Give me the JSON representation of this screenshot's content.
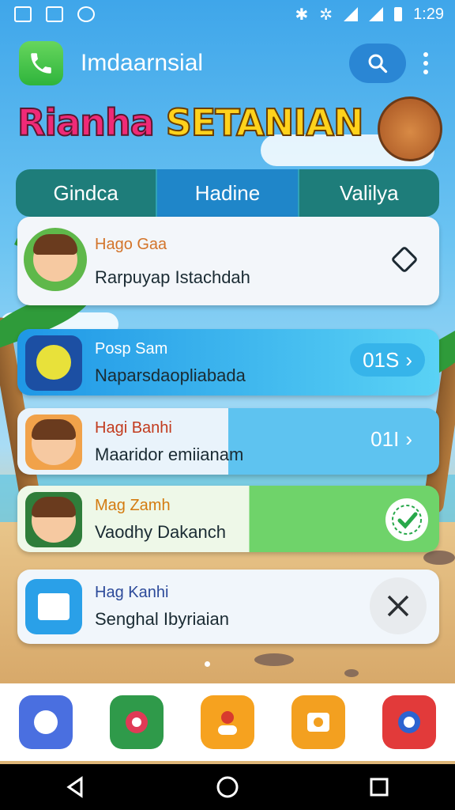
{
  "status_bar": {
    "time": "1:29"
  },
  "app_bar": {
    "title": "Imdaarnsial"
  },
  "banner": {
    "part1": "Rianha",
    "part2": "SETANIAN"
  },
  "tabs": [
    {
      "label": "Gindca"
    },
    {
      "label": "Hadine"
    },
    {
      "label": "Valilya"
    }
  ],
  "cards": [
    {
      "name": "Hago Gaa",
      "subtitle": "Rarpuyap Istachdah"
    },
    {
      "name": "Posp Sam",
      "subtitle": "Naparsdaopliabada",
      "action_label": "01S"
    },
    {
      "name": "Hagi Banhi",
      "subtitle": "Maaridor emiianam",
      "action_label": "01I"
    },
    {
      "name": "Mag Zamh",
      "subtitle": "Vaodhy Dakanch"
    },
    {
      "name": "Hag Kanhi",
      "subtitle": "Senghal Ibyriaian"
    }
  ],
  "colors": {
    "card_names": [
      "#d3742a",
      "#ffffff",
      "#c23b1e",
      "#d47b10",
      "#2c4a9a"
    ],
    "green_check": "#27a84a"
  },
  "dock": [
    "chat-app",
    "music-app",
    "contacts-app",
    "camera-app",
    "gallery-app"
  ]
}
